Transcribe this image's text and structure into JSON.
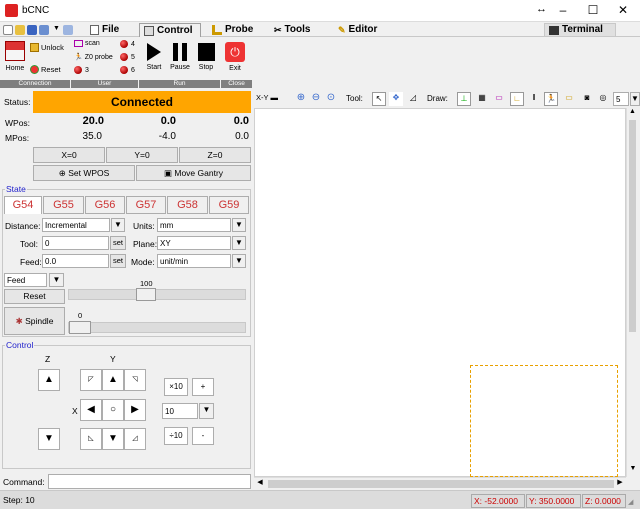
{
  "window": {
    "title": "bCNC",
    "min": "–",
    "max": "☐",
    "close": "✕",
    "resize": "↔"
  },
  "menu": {
    "file": "File",
    "control": "Control",
    "probe": "Probe",
    "tools": "Tools",
    "editor": "Editor",
    "terminal": "Terminal"
  },
  "ribbon": {
    "home": "Home",
    "unlock": "Unlock",
    "reset": "Reset",
    "scan": "scan",
    "probe": "Z0 probe",
    "count3": "3",
    "led4": "4",
    "led5": "5",
    "led6": "6",
    "start": "Start",
    "pause": "Pause",
    "stop": "Stop",
    "exit": "Exit",
    "grp_connection": "Connection",
    "grp_user": "User",
    "grp_run": "Run",
    "grp_close": "Close"
  },
  "status": {
    "label": "Status:",
    "value": "Connected",
    "color": "#ffa500"
  },
  "dro": {
    "wpos_label": "WPos:",
    "mpos_label": "MPos:",
    "wpos": [
      "20.0",
      "0.0",
      "0.0"
    ],
    "mpos": [
      "35.0",
      "-4.0",
      "0.0"
    ],
    "zero": [
      "X=0",
      "Y=0",
      "Z=0"
    ],
    "set_wpos": "Set WPOS",
    "move_gantry": "Move Gantry"
  },
  "state": {
    "legend": "State",
    "gcodes": [
      "G54",
      "G55",
      "G56",
      "G57",
      "G58",
      "G59"
    ],
    "distance_label": "Distance:",
    "distance": "Incremental",
    "units_label": "Units:",
    "units": "mm",
    "tool_label": "Tool:",
    "tool": "0",
    "set": "set",
    "plane_label": "Plane:",
    "plane": "XY",
    "feed_label": "Feed:",
    "feed": "0.0",
    "mode_label": "Mode:",
    "mode": "unit/min",
    "feed_mode": "Feed",
    "override_reset": "Reset",
    "override_value": "100",
    "spindle": "Spindle",
    "spindle_value": "0"
  },
  "control": {
    "legend": "Control",
    "z": "Z",
    "y": "Y",
    "x": "X",
    "x10": "×10",
    "plus": "+",
    "div10": "÷10",
    "minus": "-",
    "step": "10"
  },
  "command": {
    "label": "Command:",
    "value": ""
  },
  "canvas_toolbar": {
    "view": "X-Y",
    "tool_label": "Tool:",
    "draw_label": "Draw:",
    "num": "5"
  },
  "statusbar": {
    "step": "Step: 10",
    "x": "X: -52.0000",
    "y": "Y: 350.0000",
    "z": "Z: 0.0000"
  }
}
